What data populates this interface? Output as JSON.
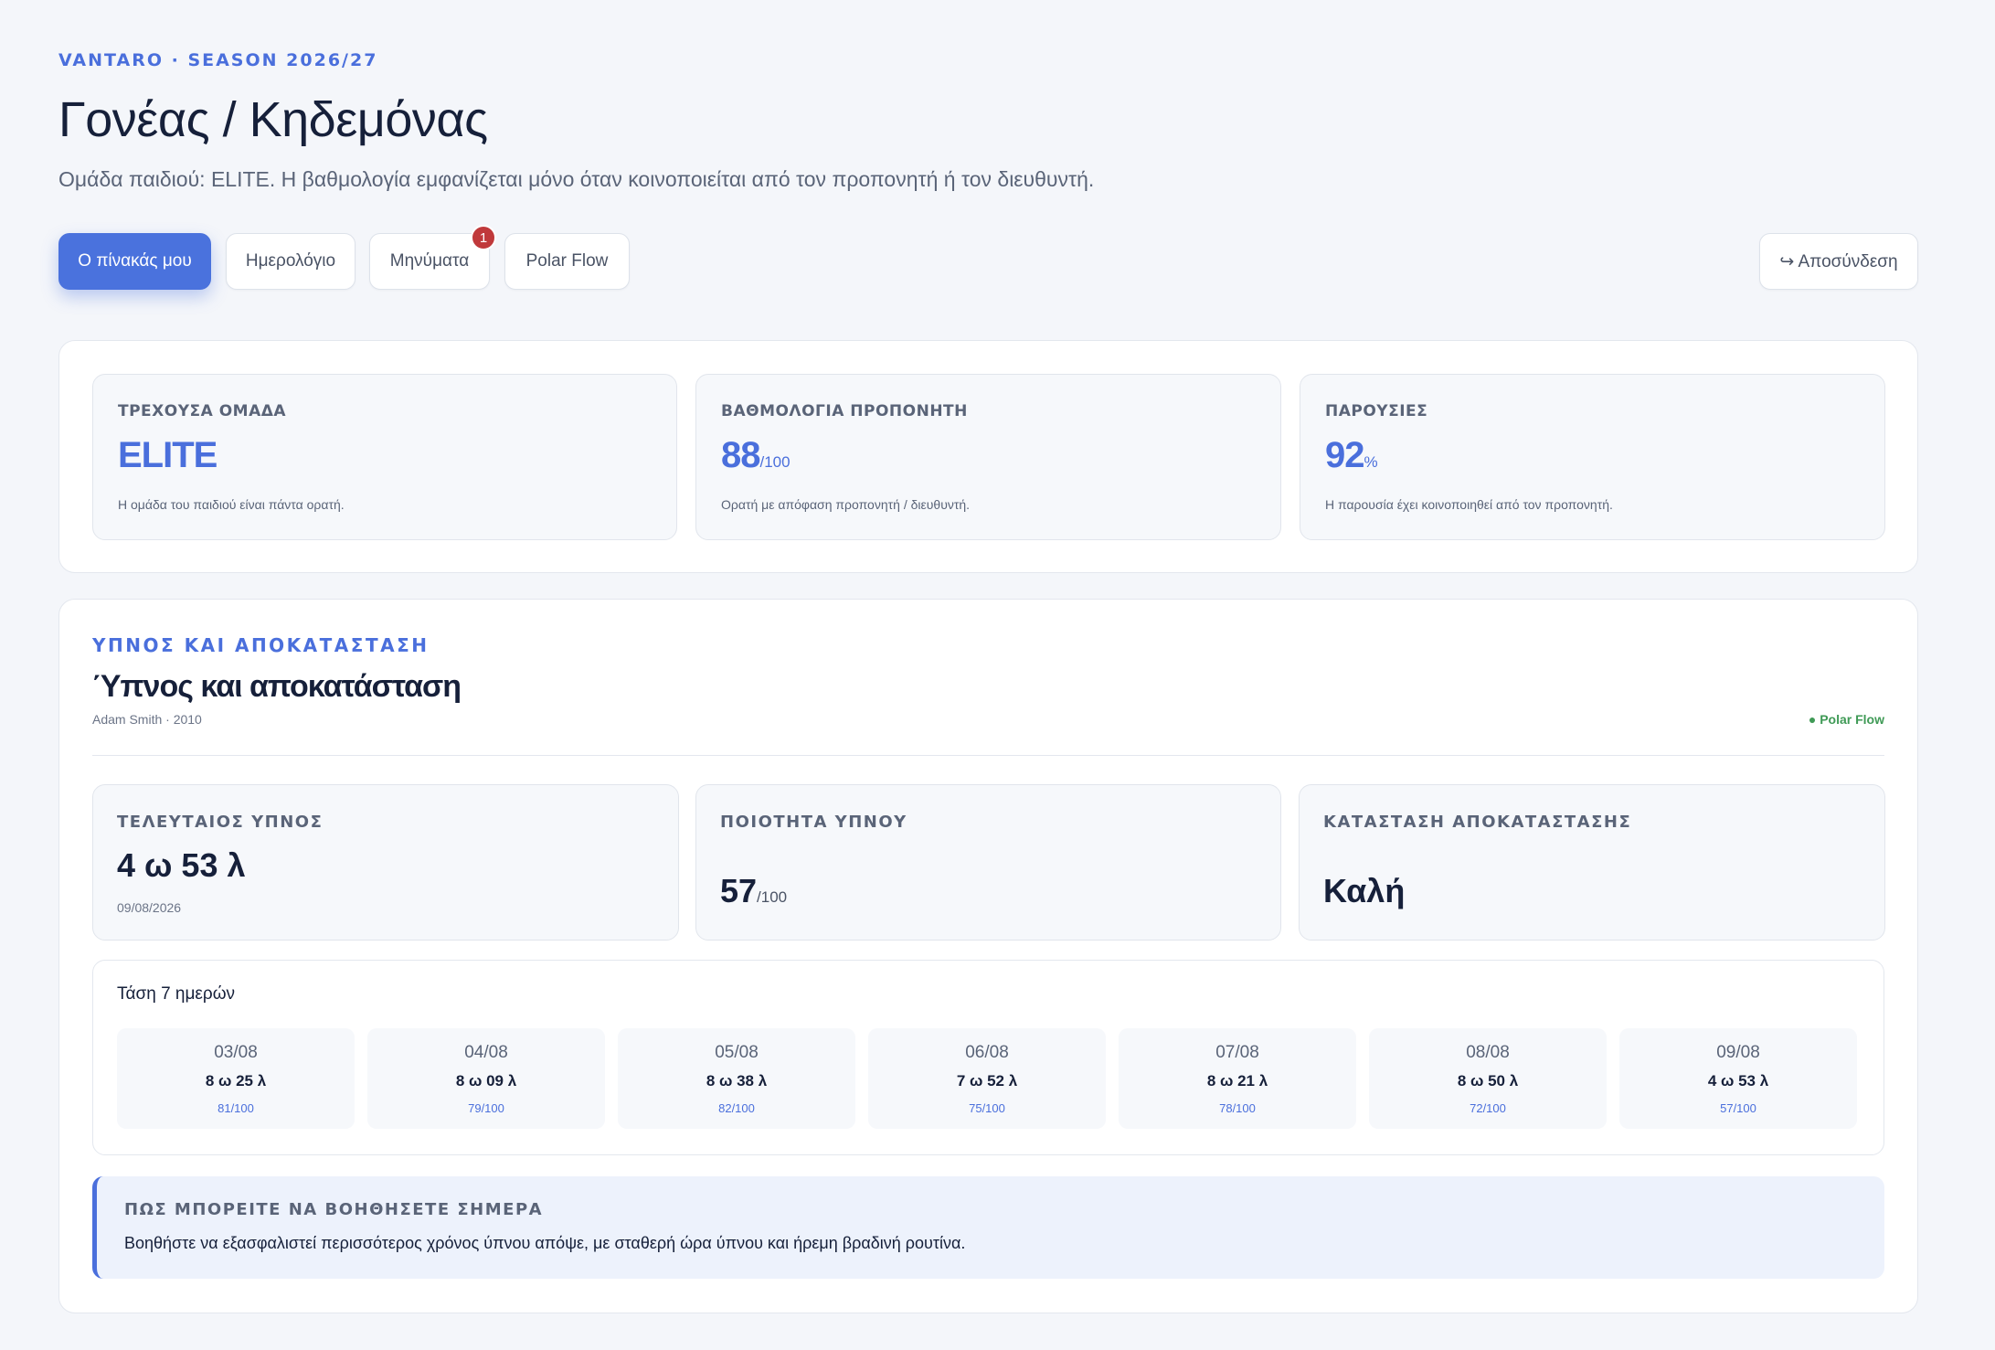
{
  "header": {
    "eyebrow": "VANTARO · SEASON 2026/27",
    "title": "Γονέας / Κηδεμόνας",
    "subtitle": "Ομάδα παιδιού: ELITE. Η βαθμολογία εμφανίζεται μόνο όταν κοινοποιείται από τον προπονητή ή τον διευθυντή."
  },
  "nav": {
    "tabs": [
      {
        "label": "Ο πίνακάς μου",
        "active": true
      },
      {
        "label": "Ημερολόγιο",
        "active": false
      },
      {
        "label": "Μηνύματα",
        "active": false,
        "badge": "1"
      },
      {
        "label": "Polar Flow",
        "active": false
      }
    ],
    "logout_icon": "logout-arrow-icon",
    "logout_label": "↪ Αποσύνδεση"
  },
  "summary": {
    "team": {
      "label": "ΤΡΕΧΟΥΣΑ ΟΜΑΔΑ",
      "value": "ELITE",
      "unit": "",
      "note": "Η ομάδα του παιδιού είναι πάντα ορατή."
    },
    "rating": {
      "label": "ΒΑΘΜΟΛΟΓΙΑ ΠΡΟΠΟΝΗΤΗ",
      "value": "88",
      "unit": "/100",
      "note": "Ορατή με απόφαση προπονητή / διευθυντή."
    },
    "attendance": {
      "label": "ΠΑΡΟΥΣΙΕΣ",
      "value": "92",
      "unit": "%",
      "note": "Η παρουσία έχει κοινοποιηθεί από τον προπονητή."
    }
  },
  "sleep": {
    "eyebrow": "ΥΠΝΟΣ ΚΑΙ ΑΠΟΚΑΤΑΣΤΑΣΗ",
    "title": "Ύπνος και αποκατάσταση",
    "meta": "Adam Smith · 2010",
    "source": "● Polar Flow",
    "source_color": "#3f9a56",
    "last_sleep": {
      "label": "ΤΕΛΕΥΤΑΙΟΣ ΥΠΝΟΣ",
      "value": "4 ω 53 λ",
      "note": "09/08/2026"
    },
    "quality": {
      "label": "ΠΟΙΟΤΗΤΑ ΥΠΝΟΥ",
      "value": "57",
      "unit": "/100"
    },
    "recovery": {
      "label": "ΚΑΤΑΣΤΑΣΗ ΑΠΟΚΑΤΑΣΤΑΣΗΣ",
      "value": "Καλή"
    },
    "trend": {
      "title": "Τάση 7 ημερών",
      "days": [
        {
          "date": "03/08",
          "duration": "8 ω 25 λ",
          "score": "81/100"
        },
        {
          "date": "04/08",
          "duration": "8 ω 09 λ",
          "score": "79/100"
        },
        {
          "date": "05/08",
          "duration": "8 ω 38 λ",
          "score": "82/100"
        },
        {
          "date": "06/08",
          "duration": "7 ω 52 λ",
          "score": "75/100"
        },
        {
          "date": "07/08",
          "duration": "8 ω 21 λ",
          "score": "78/100"
        },
        {
          "date": "08/08",
          "duration": "8 ω 50 λ",
          "score": "72/100"
        },
        {
          "date": "09/08",
          "duration": "4 ω 53 λ",
          "score": "57/100"
        }
      ]
    },
    "help": {
      "title": "ΠΩΣ ΜΠΟΡΕΙΤΕ ΝΑ ΒΟΗΘΗΣΕΤΕ ΣΗΜΕΡΑ",
      "text": "Βοηθήστε να εξασφαλιστεί περισσότερος χρόνος ύπνου απόψε, με σταθερή ώρα ύπνου και ήρεμη βραδινή ρουτίνα."
    }
  },
  "colors": {
    "accent": "#4a72dd",
    "badge": "#c0393b",
    "success": "#3f9a56"
  }
}
